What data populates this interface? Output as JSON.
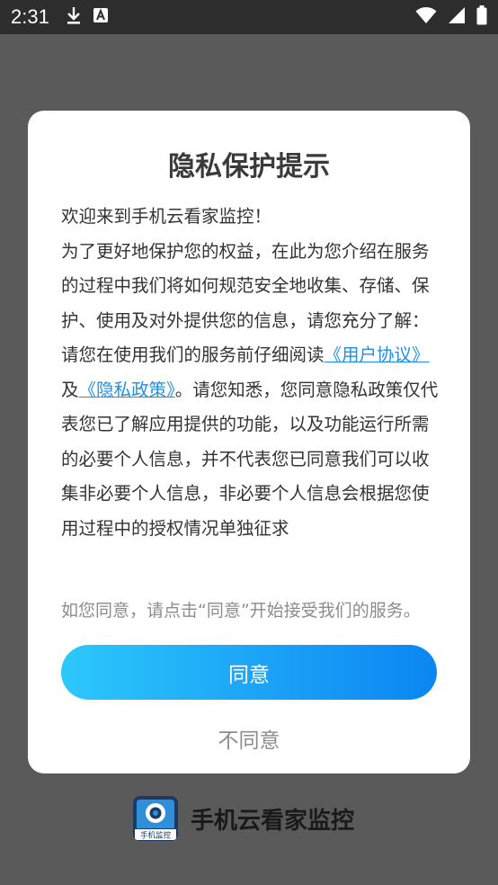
{
  "status_bar": {
    "time": "2:31",
    "left_icons": [
      "download-icon",
      "a-badge-icon"
    ],
    "right_icons": [
      "wifi-icon",
      "signal-icon",
      "battery-icon"
    ]
  },
  "dialog": {
    "title": "隐私保护提示",
    "paragraphs": [
      "欢迎来到手机云看家监控！",
      "为了更好地保护您的权益，在此为您介绍在服务的过程中我们将如何规范安全地收集、存储、保护、使用及对外提供您的信息，请您充分了解："
    ],
    "para3_prefix": "请您在使用我们的服务前仔细阅读",
    "user_agreement_link": "《用户协议》",
    "and_text": "及",
    "privacy_policy_link": "《隐私政策》",
    "para3_suffix": "。请您知悉，您同意隐私政策仅代表您已了解应用提供的功能，以及功能运行所需的必要个人信息，并不代表您已同意我们可以收集非必要个人信息，非必要个人信息会根据您使用过程中的授权情况单独征求",
    "hint": "如您同意，请点击“同意”开始接受我们的服务。",
    "agree_label": "同意",
    "disagree_label": "不同意"
  },
  "app_brand": {
    "logo_icon": "camera-logo-icon",
    "logo_caption": "手机监控",
    "name": "手机云看家监控"
  },
  "colors": {
    "link": "#1e90e8",
    "button_gradient_start": "#2cc8fb",
    "button_gradient_end": "#0b86f2",
    "overlay": "#5a5a5a",
    "status_bar": "#2d2d2d"
  }
}
